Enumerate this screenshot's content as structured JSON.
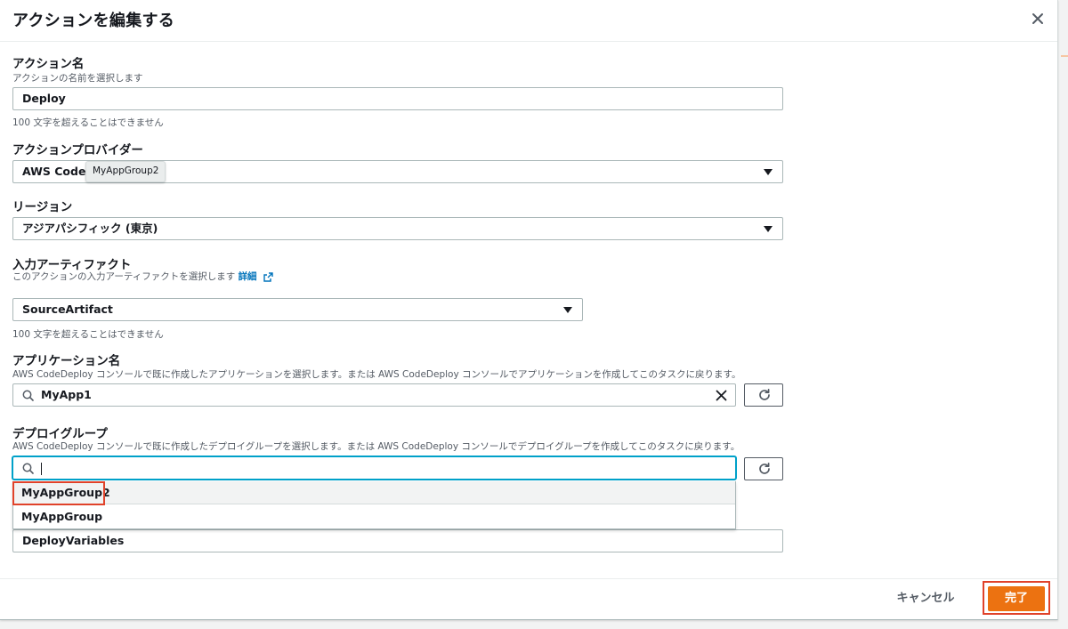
{
  "modal": {
    "title": "アクションを編集する"
  },
  "action_name": {
    "label": "アクション名",
    "description": "アクションの名前を選択します",
    "value": "Deploy",
    "constraint": "100 文字を超えることはできません"
  },
  "provider": {
    "label": "アクションプロバイダー",
    "value": "AWS CodeDeploy",
    "tooltip": "MyAppGroup2"
  },
  "region": {
    "label": "リージョン",
    "value": "アジアパシフィック (東京)"
  },
  "input_artifact": {
    "label": "入力アーティファクト",
    "description": "このアクションの入力アーティファクトを選択します",
    "learn_more": "詳細",
    "value": "SourceArtifact",
    "constraint": "100 文字を超えることはできません"
  },
  "application": {
    "label": "アプリケーション名",
    "description": "AWS CodeDeploy コンソールで既に作成したアプリケーションを選択します。または AWS CodeDeploy コンソールでアプリケーションを作成してこのタスクに戻ります。",
    "value": "MyApp1"
  },
  "deploy_group": {
    "label": "デプロイグループ",
    "description": "AWS CodeDeploy コンソールで既に作成したデプロイグループを選択します。または AWS CodeDeploy コンソールでデプロイグループを作成してこのタスクに戻ります。",
    "value": "",
    "options": [
      "MyAppGroup2",
      "MyAppGroup"
    ]
  },
  "variable_namespace": {
    "value": "DeployVariables"
  },
  "footer": {
    "cancel_label": "キャンセル",
    "done_label": "完了"
  },
  "colors": {
    "accent": "#ec7211",
    "link": "#0073bb",
    "annotation": "#e0422a",
    "focus": "#00a1c9"
  }
}
